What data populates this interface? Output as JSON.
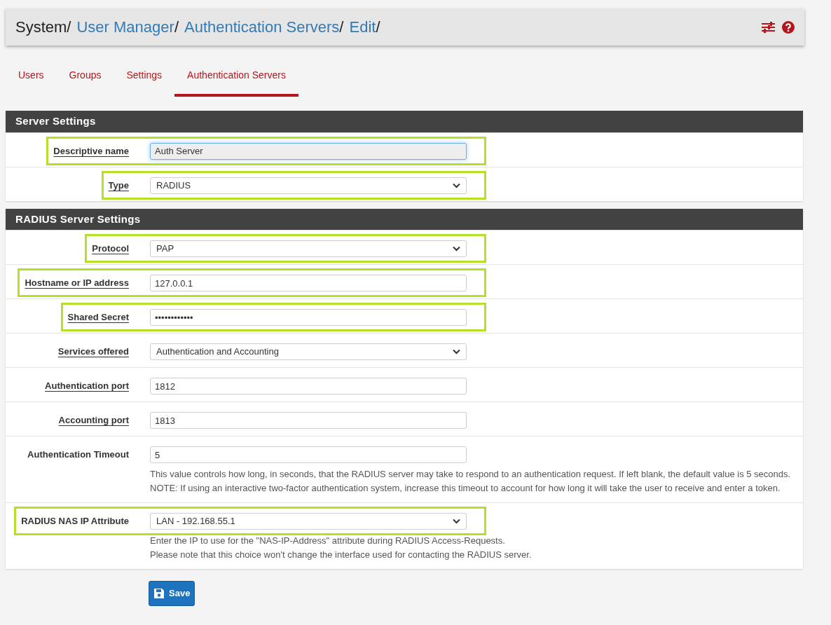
{
  "breadcrumb": [
    {
      "label": "System",
      "link": false,
      "separator": "/"
    },
    {
      "label": "User Manager",
      "link": true,
      "separator": "/"
    },
    {
      "label": "Authentication Servers",
      "link": true,
      "separator": "/"
    },
    {
      "label": "Edit",
      "link": true,
      "separator": "/"
    }
  ],
  "tabs": [
    {
      "label": "Users",
      "selected": false
    },
    {
      "label": "Groups",
      "selected": false
    },
    {
      "label": "Settings",
      "selected": false
    },
    {
      "label": "Authentication Servers",
      "selected": true
    }
  ],
  "panels": [
    {
      "title": "Server Settings",
      "rows": [
        {
          "label": "Descriptive name",
          "underlined": true,
          "highlighted": true,
          "kind": "text",
          "value": "Auth Server",
          "readonly": true
        },
        {
          "label": "Type",
          "underlined": true,
          "highlighted": true,
          "kind": "select",
          "value": "RADIUS"
        }
      ]
    },
    {
      "title": "RADIUS Server Settings",
      "rows": [
        {
          "label": "Protocol",
          "underlined": true,
          "highlighted": true,
          "kind": "select",
          "value": "PAP"
        },
        {
          "label": "Hostname or IP address",
          "underlined": true,
          "highlighted": true,
          "kind": "text",
          "value": "127.0.0.1"
        },
        {
          "label": "Shared Secret",
          "underlined": true,
          "highlighted": true,
          "kind": "password",
          "value": "••••••••••••"
        },
        {
          "label": "Services offered",
          "underlined": true,
          "highlighted": false,
          "kind": "select",
          "value": "Authentication and Accounting"
        },
        {
          "label": "Authentication port",
          "underlined": true,
          "highlighted": false,
          "kind": "text",
          "value": "1812"
        },
        {
          "label": "Accounting port",
          "underlined": true,
          "highlighted": false,
          "kind": "text",
          "value": "1813"
        },
        {
          "label": "Authentication Timeout",
          "underlined": false,
          "highlighted": false,
          "kind": "text",
          "value": "5",
          "help": [
            "This value controls how long, in seconds, that the RADIUS server may take to respond to an authentication request. If left blank, the default value is 5 seconds. NOTE: If using an interactive two-factor authentication system, increase this timeout to account for how long it will take the user to receive and enter a token."
          ]
        },
        {
          "label": "RADIUS NAS IP Attribute",
          "underlined": false,
          "highlighted": true,
          "kind": "select",
          "value": "LAN - 192.168.55.1",
          "help": [
            "Enter the IP to use for the \"NAS-IP-Address\" attribute during RADIUS Access-Requests.",
            "Please note that this choice won't change the interface used for contacting the RADIUS server."
          ]
        }
      ]
    }
  ],
  "save_button": "Save"
}
